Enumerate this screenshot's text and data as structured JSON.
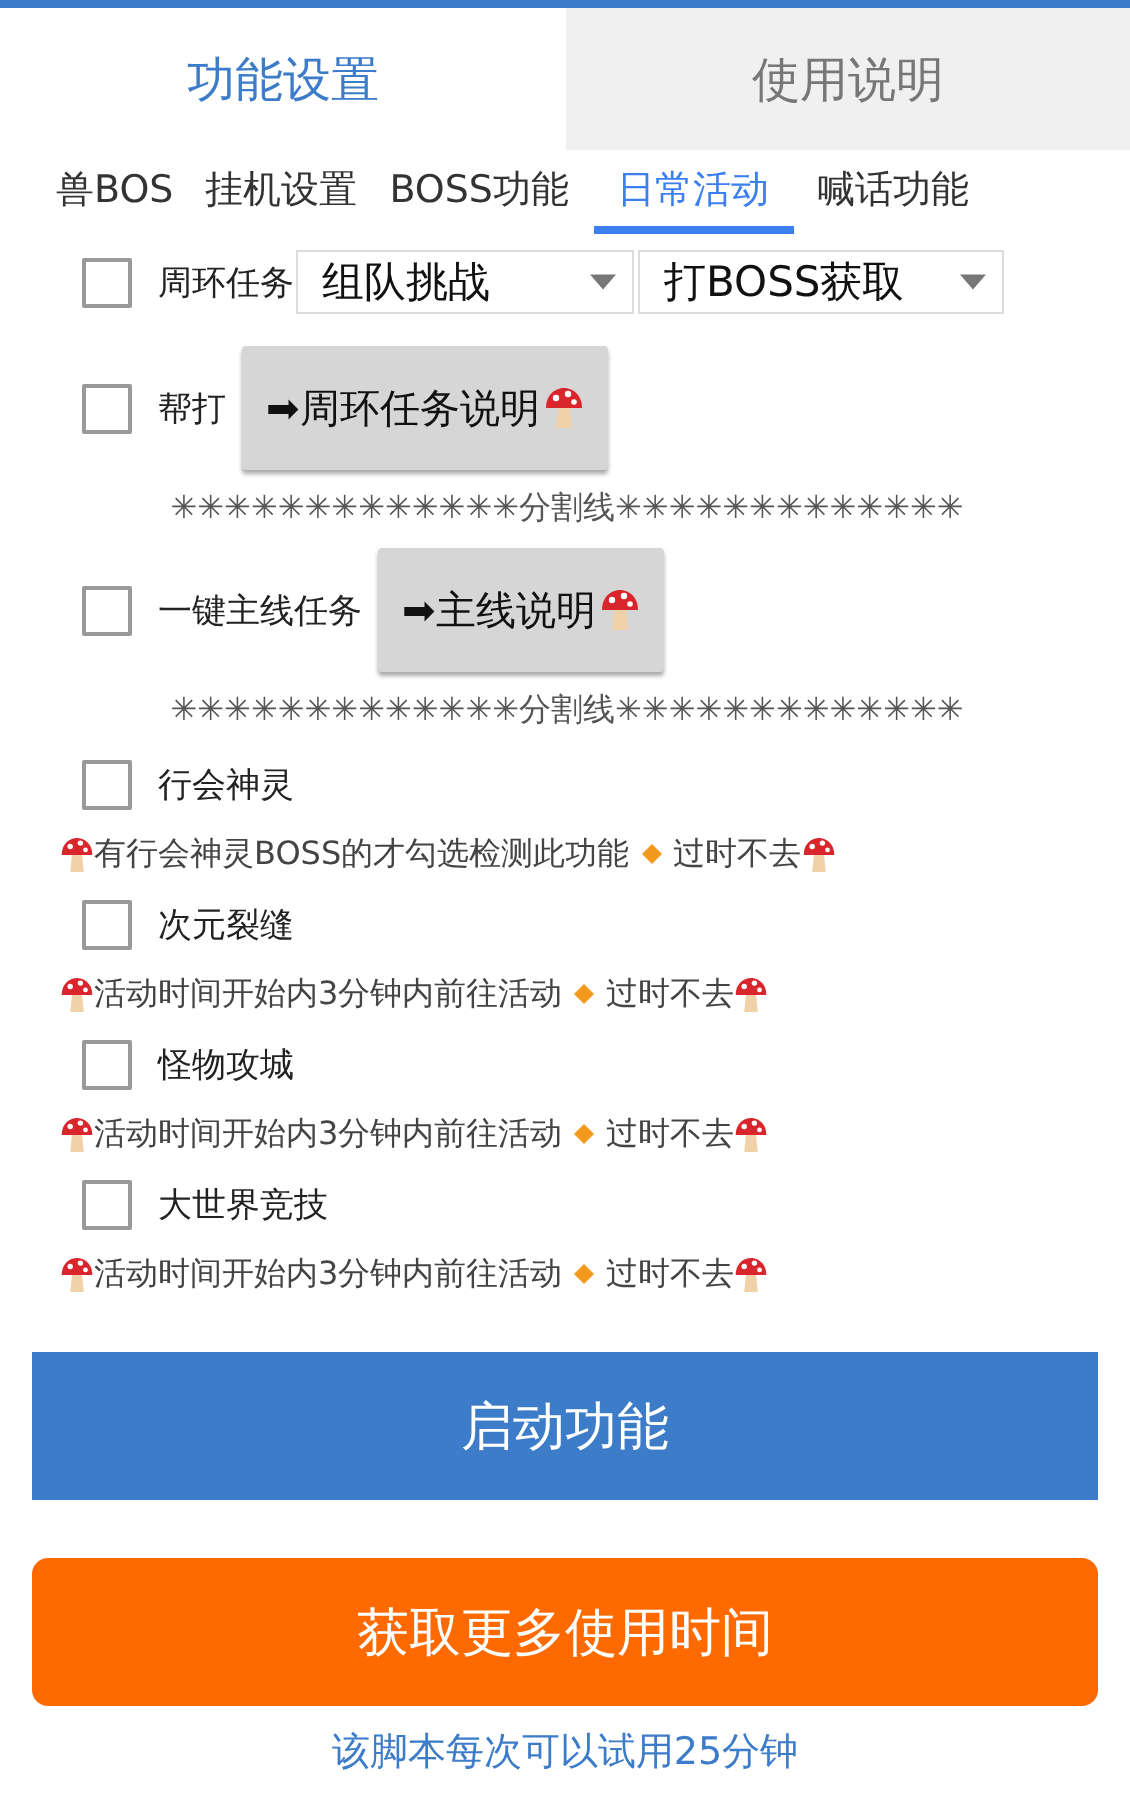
{
  "tabs": [
    {
      "label": "功能设置",
      "selected": true
    },
    {
      "label": "使用说明",
      "selected": false
    }
  ],
  "subtabs": [
    {
      "label": "兽BOS",
      "selected": false
    },
    {
      "label": "挂机设置",
      "selected": false
    },
    {
      "label": "BOSS功能",
      "selected": false
    },
    {
      "label": "日常活动",
      "selected": true
    },
    {
      "label": "喊话功能",
      "selected": false
    }
  ],
  "items": [
    {
      "kind": "dropdowns",
      "label": "周环任务",
      "checked": false,
      "selects": [
        "组队挑战",
        "打BOSS获取"
      ]
    },
    {
      "kind": "button",
      "label": "帮打",
      "checked": false,
      "button": "➡周环任务说明"
    },
    {
      "kind": "divider",
      "text": "✳✳✳✳✳✳✳✳✳✳✳✳✳分割线✳✳✳✳✳✳✳✳✳✳✳✳✳"
    },
    {
      "kind": "button",
      "label": "一键主线任务",
      "checked": false,
      "button": "➡主线说明"
    },
    {
      "kind": "divider",
      "text": "✳✳✳✳✳✳✳✳✳✳✳✳✳分割线✳✳✳✳✳✳✳✳✳✳✳✳✳"
    },
    {
      "kind": "check",
      "label": "行会神灵",
      "checked": false
    },
    {
      "kind": "note",
      "parts": [
        "有行会神灵BOSS的才勾选检测此功能",
        "过时不去"
      ]
    },
    {
      "kind": "check",
      "label": "次元裂缝",
      "checked": false
    },
    {
      "kind": "note",
      "parts": [
        "活动时间开始内3分钟内前往活动",
        "过时不去"
      ]
    },
    {
      "kind": "check",
      "label": "怪物攻城",
      "checked": false
    },
    {
      "kind": "note",
      "parts": [
        "活动时间开始内3分钟内前往活动",
        "过时不去"
      ]
    },
    {
      "kind": "check",
      "label": "大世界竞技",
      "checked": false
    },
    {
      "kind": "note",
      "parts": [
        "活动时间开始内3分钟内前往活动",
        "过时不去"
      ]
    }
  ],
  "start_button": "启动功能",
  "more_button": "获取更多使用时间",
  "footer": "该脚本每次可以试用25分钟"
}
